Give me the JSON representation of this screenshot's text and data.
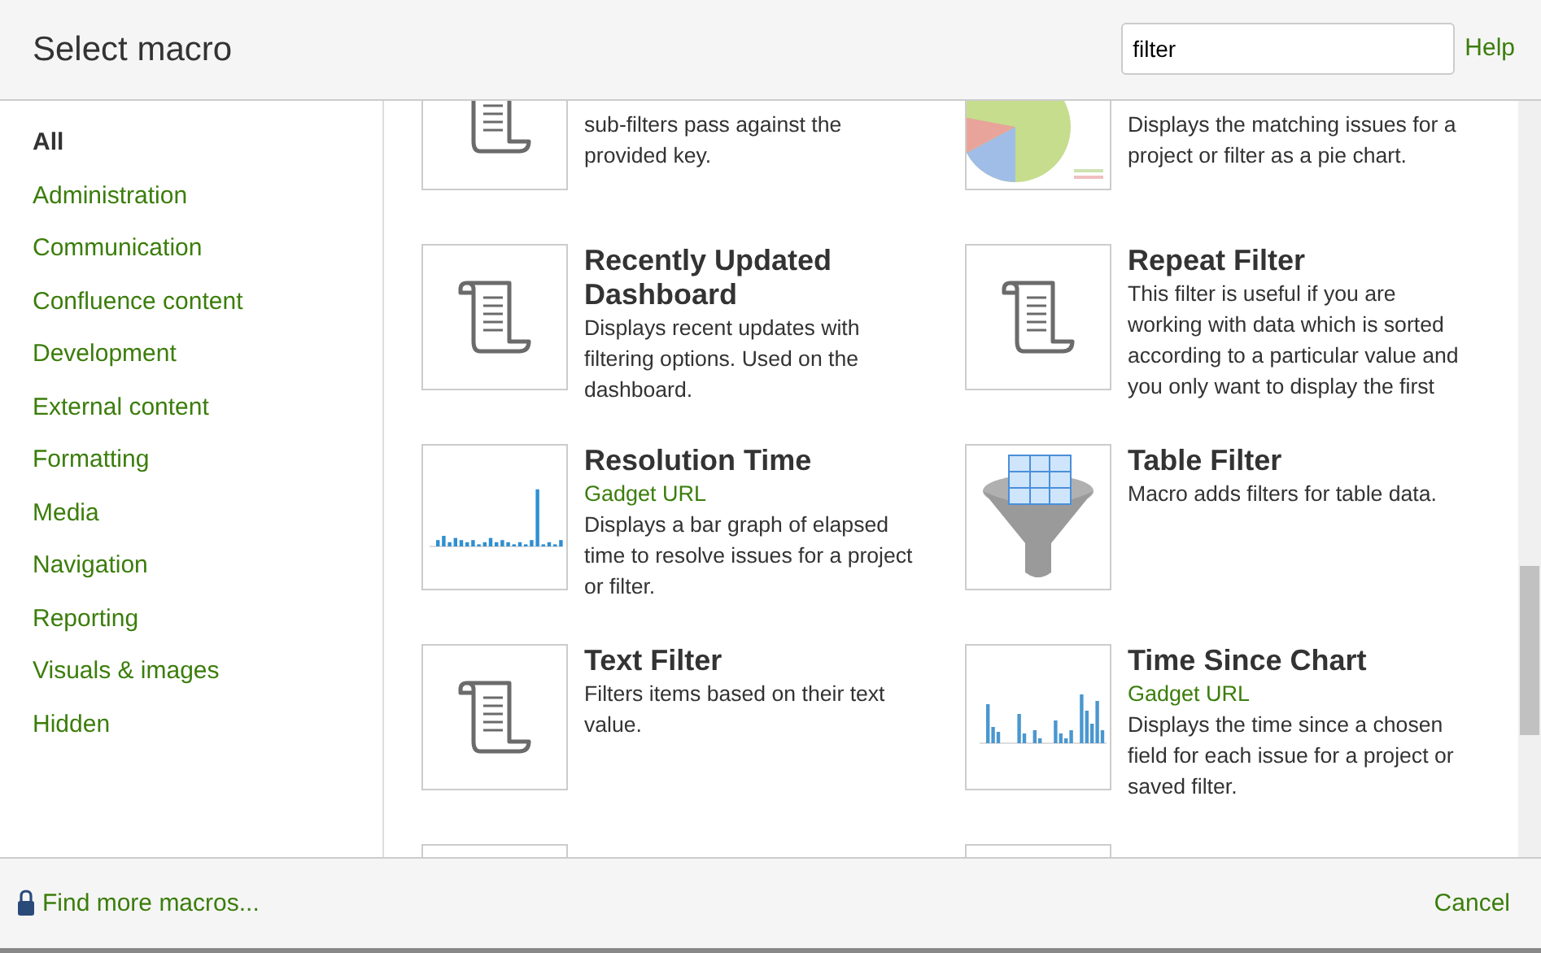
{
  "window": {
    "title": "Select macro"
  },
  "search": {
    "value": "filter"
  },
  "help_link": "Help",
  "sidebar": {
    "items": [
      {
        "label": "All",
        "selected": true
      },
      {
        "label": "Administration",
        "selected": false
      },
      {
        "label": "Communication",
        "selected": false
      },
      {
        "label": "Confluence content",
        "selected": false
      },
      {
        "label": "Development",
        "selected": false
      },
      {
        "label": "External content",
        "selected": false
      },
      {
        "label": "Formatting",
        "selected": false
      },
      {
        "label": "Media",
        "selected": false
      },
      {
        "label": "Navigation",
        "selected": false
      },
      {
        "label": "Reporting",
        "selected": false
      },
      {
        "label": "Visuals & images",
        "selected": false
      },
      {
        "label": "Hidden",
        "selected": false
      }
    ]
  },
  "macros": [
    {
      "kind": "scroll",
      "description": "sub-filters pass against the provided key."
    },
    {
      "kind": "pie",
      "description": "Displays the matching issues for a project or filter as a pie chart."
    },
    {
      "kind": "scroll",
      "title": "Recently Updated Dashboard",
      "description": "Displays recent updates with filtering options. Used on the dashboard."
    },
    {
      "kind": "scroll",
      "title": "Repeat Filter",
      "description": "This filter is useful if you are working with data which is sorted according to a particular value and you only want to display the first"
    },
    {
      "kind": "bars",
      "title": "Resolution Time",
      "subtitle": "Gadget URL",
      "description": "Displays a bar graph of elapsed time to resolve issues for a project or filter."
    },
    {
      "kind": "funnel",
      "title": "Table Filter",
      "description": "Macro adds filters for table data."
    },
    {
      "kind": "scroll",
      "title": "Text Filter",
      "description": "Filters items based on their text value."
    },
    {
      "kind": "columns",
      "title": "Time Since Chart",
      "subtitle": "Gadget URL",
      "description": "Displays the time since a chosen field for each issue for a project or saved filter."
    },
    {
      "kind": "blank"
    },
    {
      "kind": "blank"
    }
  ],
  "footer": {
    "link": "Find more macros...",
    "cancel": "Cancel"
  }
}
